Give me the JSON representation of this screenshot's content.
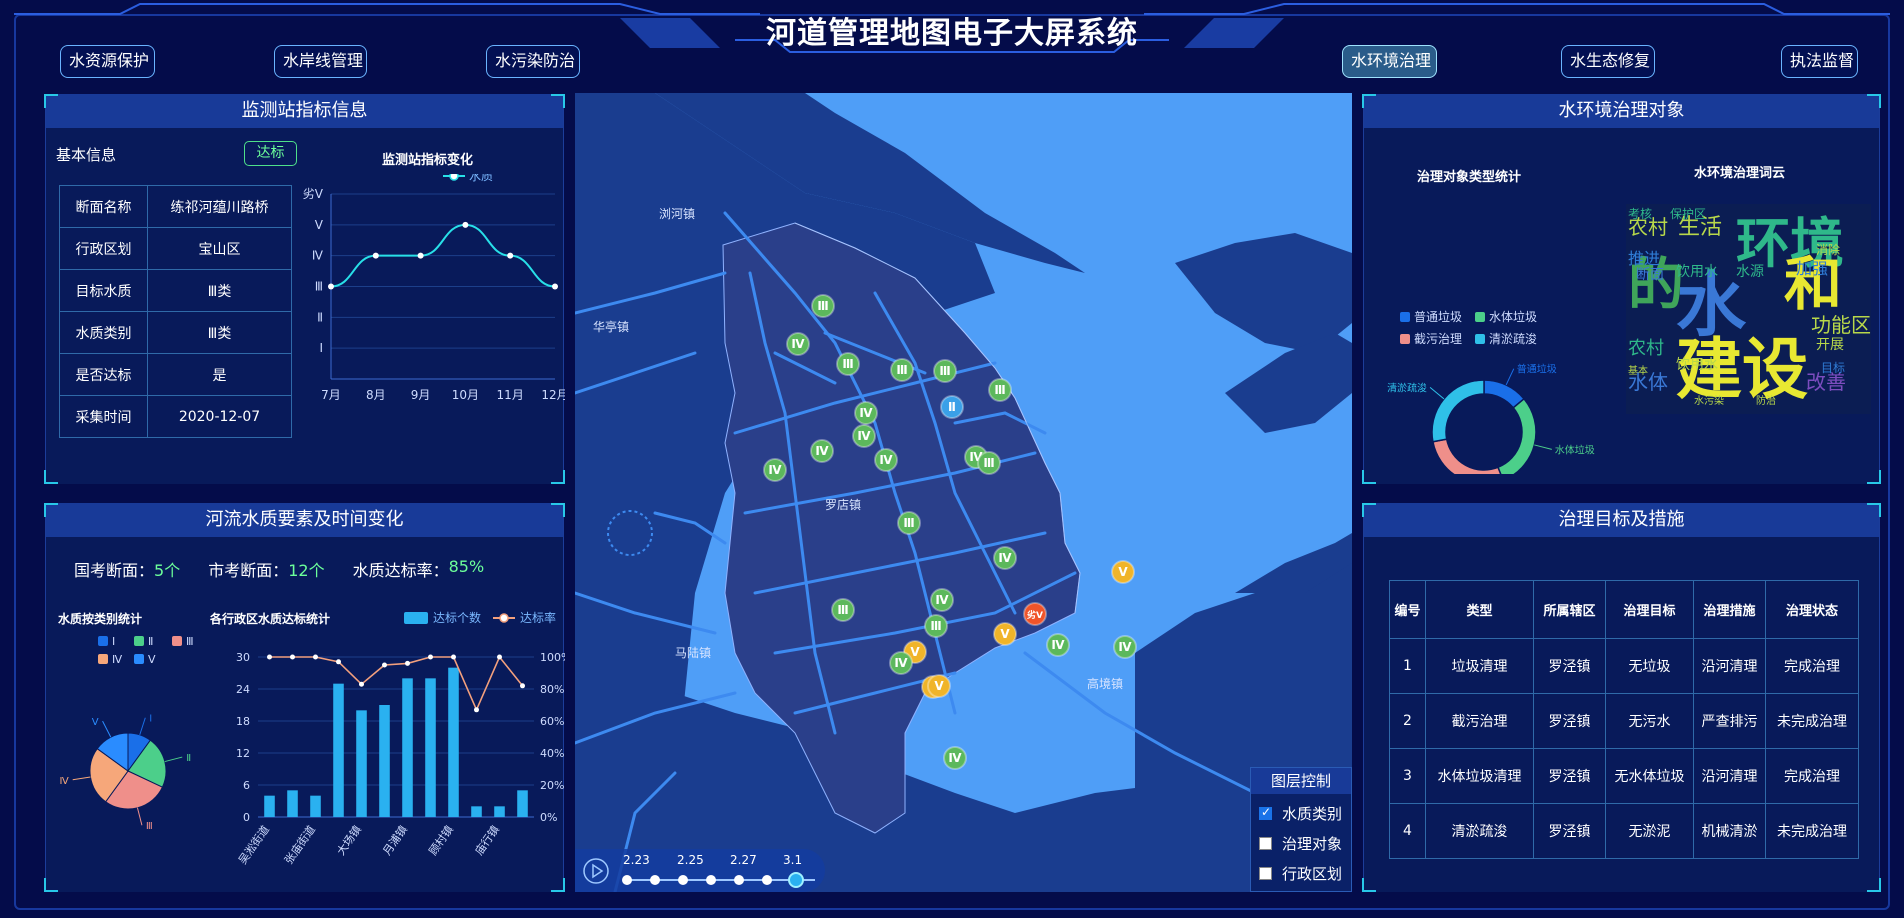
{
  "header": {
    "title": "河道管理地图电子大屏系统"
  },
  "nav": [
    {
      "label": "水资源保护",
      "active": false
    },
    {
      "label": "水岸线管理",
      "active": false
    },
    {
      "label": "水污染防治",
      "active": false
    },
    {
      "label": "水环境治理",
      "active": true
    },
    {
      "label": "水生态修复",
      "active": false
    },
    {
      "label": "执法监督",
      "active": false
    }
  ],
  "station_panel": {
    "title": "监测站指标信息",
    "basic_info_label": "基本信息",
    "status_badge": "达标",
    "rows": [
      {
        "key": "断面名称",
        "value": "练祁河蕴川路桥"
      },
      {
        "key": "行政区划",
        "value": "宝山区"
      },
      {
        "key": "目标水质",
        "value": "Ⅲ类"
      },
      {
        "key": "水质类别",
        "value": "Ⅲ类"
      },
      {
        "key": "是否达标",
        "value": "是"
      },
      {
        "key": "采集时间",
        "value": "2020-12-07"
      }
    ],
    "chart_title": "监测站指标变化",
    "legend": "水质"
  },
  "river_panel": {
    "title": "河流水质要素及时间变化",
    "stats": [
      {
        "label": "国考断面：",
        "value": "5个"
      },
      {
        "label": "市考断面：",
        "value": "12个"
      },
      {
        "label": "水质达标率：",
        "value": "85%"
      }
    ],
    "pie_title": "水质按类别统计",
    "bar_title": "各行政区水质达标统计",
    "bar_legend_count": "达标个数",
    "bar_legend_rate": "达标率"
  },
  "env_panel": {
    "title": "水环境治理对象",
    "donut_title": "治理对象类型统计",
    "wordcloud_title": "水环境治理词云",
    "words": [
      {
        "text": "环境",
        "color": "#2fb88a"
      },
      {
        "text": "水",
        "color": "#3a78d6"
      },
      {
        "text": "和",
        "color": "#e8e832"
      },
      {
        "text": "的",
        "color": "#3fa55a"
      },
      {
        "text": "建设",
        "color": "#e8e832"
      },
      {
        "text": "农村",
        "color": "#b8d84a"
      },
      {
        "text": "生活",
        "color": "#b8d84a"
      },
      {
        "text": "功能区",
        "color": "#b8d84a"
      },
      {
        "text": "水体",
        "color": "#3a78d6"
      },
      {
        "text": "改善",
        "color": "#7c4dbf"
      },
      {
        "text": "推进",
        "color": "#2f7cd6"
      },
      {
        "text": "加强",
        "color": "#2f7cd6"
      },
      {
        "text": "饮用水",
        "color": "#2fb88a"
      },
      {
        "text": "农村",
        "color": "#2fb88a"
      },
      {
        "text": "开展",
        "color": "#b8d84a"
      },
      {
        "text": "考核",
        "color": "#2fb88a"
      },
      {
        "text": "保护区",
        "color": "#2fb88a"
      },
      {
        "text": "饮用水",
        "color": "#b8d84a"
      },
      {
        "text": "水源",
        "color": "#2fb88a"
      },
      {
        "text": "目标",
        "color": "#2f7cd6"
      },
      {
        "text": "水污染",
        "color": "#b8d84a"
      },
      {
        "text": "防治",
        "color": "#b8d84a"
      },
      {
        "text": "断面",
        "color": "#3a78d6"
      },
      {
        "text": "基本",
        "color": "#b8d84a"
      },
      {
        "text": "消除",
        "color": "#b8d84a"
      }
    ]
  },
  "measure_panel": {
    "title": "治理目标及措施",
    "headers": [
      "编号",
      "类型",
      "所属辖区",
      "治理目标",
      "治理措施",
      "治理状态"
    ],
    "rows": [
      [
        "1",
        "垃圾清理",
        "罗泾镇",
        "无垃圾",
        "沿河清理",
        "完成治理"
      ],
      [
        "2",
        "截污治理",
        "罗泾镇",
        "无污水",
        "严查排污",
        "未完成治理"
      ],
      [
        "3",
        "水体垃圾清理",
        "罗泾镇",
        "无水体垃圾",
        "沿河清理",
        "完成治理"
      ],
      [
        "4",
        "清淤疏浚",
        "罗泾镇",
        "无淤泥",
        "机械清淤",
        "未完成治理"
      ]
    ]
  },
  "map": {
    "place_labels": [
      "浏河镇",
      "华亭镇",
      "罗店镇",
      "马陆镇",
      "高境镇"
    ],
    "markers": [
      {
        "label": "Ⅲ",
        "kind": "green"
      },
      {
        "label": "Ⅳ",
        "kind": "green"
      },
      {
        "label": "Ⅲ",
        "kind": "green"
      },
      {
        "label": "Ⅲ",
        "kind": "green"
      },
      {
        "label": "Ⅲ",
        "kind": "green"
      },
      {
        "label": "Ⅲ",
        "kind": "green"
      },
      {
        "label": "Ⅱ",
        "kind": "blue"
      },
      {
        "label": "Ⅳ",
        "kind": "green"
      },
      {
        "label": "Ⅳ",
        "kind": "green"
      },
      {
        "label": "Ⅳ",
        "kind": "green"
      },
      {
        "label": "Ⅳ",
        "kind": "green"
      },
      {
        "label": "Ⅳ",
        "kind": "green"
      },
      {
        "label": "Ⅳ",
        "kind": "green"
      },
      {
        "label": "Ⅲ",
        "kind": "green"
      },
      {
        "label": "Ⅲ",
        "kind": "green"
      },
      {
        "label": "Ⅳ",
        "kind": "green"
      },
      {
        "label": "Ⅴ",
        "kind": "yellow"
      },
      {
        "label": "Ⅲ",
        "kind": "green"
      },
      {
        "label": "Ⅳ",
        "kind": "green"
      },
      {
        "label": "Ⅲ",
        "kind": "green"
      },
      {
        "label": "Ⅴ",
        "kind": "yellow"
      },
      {
        "label": "劣Ⅴ",
        "kind": "red"
      },
      {
        "label": "Ⅳ",
        "kind": "green"
      },
      {
        "label": "Ⅴ",
        "kind": "yellow"
      },
      {
        "label": "Ⅳ",
        "kind": "green"
      },
      {
        "label": "Ⅴ",
        "kind": "yellow"
      },
      {
        "label": "Ⅳ",
        "kind": "green"
      },
      {
        "label": "Ⅴ",
        "kind": "yellow"
      },
      {
        "label": "Ⅳ",
        "kind": "green"
      }
    ],
    "timeline_labels": [
      "2.23",
      "2.25",
      "2.27",
      "3.1"
    ],
    "layer_title": "图层控制",
    "layers": [
      {
        "label": "水质类别",
        "checked": true
      },
      {
        "label": "治理对象",
        "checked": false
      },
      {
        "label": "行政区划",
        "checked": false
      }
    ]
  },
  "chart_data": [
    {
      "type": "line",
      "title": "监测站指标变化",
      "categories": [
        "7月",
        "8月",
        "9月",
        "10月",
        "11月",
        "12月"
      ],
      "y_ticks": [
        "Ⅰ",
        "Ⅱ",
        "Ⅲ",
        "Ⅳ",
        "Ⅴ",
        "劣Ⅴ"
      ],
      "series": [
        {
          "name": "水质",
          "values": [
            3,
            4,
            4,
            5,
            4,
            3
          ]
        }
      ],
      "ylim": [
        0,
        6
      ],
      "color": "#28e0e8"
    },
    {
      "type": "pie",
      "title": "水质按类别统计",
      "labels": [
        "Ⅰ",
        "Ⅱ",
        "Ⅲ",
        "Ⅳ",
        "Ⅴ"
      ],
      "values": [
        10,
        22,
        28,
        25,
        15
      ],
      "colors": [
        "#1a6fe8",
        "#4ccf8a",
        "#ef8f8a",
        "#f6a77a",
        "#2a8cff"
      ]
    },
    {
      "type": "bar",
      "title": "各行政区水质达标统计",
      "categories": [
        "吴淞街道",
        "",
        "张庙街道",
        "",
        "大场镇",
        "",
        "月浦镇",
        "",
        "顾村镇",
        "",
        "庙行镇",
        ""
      ],
      "series": [
        {
          "name": "达标个数",
          "values": [
            4,
            5,
            4,
            25,
            20,
            21,
            26,
            26,
            28,
            2,
            2,
            5
          ]
        },
        {
          "name": "达标率",
          "values": [
            100,
            100,
            100,
            97,
            83,
            95,
            96,
            100,
            100,
            67,
            100,
            82
          ]
        }
      ],
      "y_ticks_left": [
        0,
        6,
        12,
        18,
        24,
        30
      ],
      "y_ticks_right": [
        "0%",
        "20%",
        "40%",
        "60%",
        "80%",
        "100%"
      ],
      "ylim": [
        0,
        30
      ],
      "colors": [
        "#2ab1f0",
        "#f3a07d"
      ]
    },
    {
      "type": "pie",
      "title": "治理对象类型统计",
      "labels": [
        "普通垃圾",
        "水体垃圾",
        "截污治理",
        "清淤疏浚"
      ],
      "values": [
        14,
        30,
        28,
        28
      ],
      "colors": [
        "#1a6fe8",
        "#4ccf8a",
        "#ef8f8a",
        "#2fc0e8"
      ]
    }
  ]
}
